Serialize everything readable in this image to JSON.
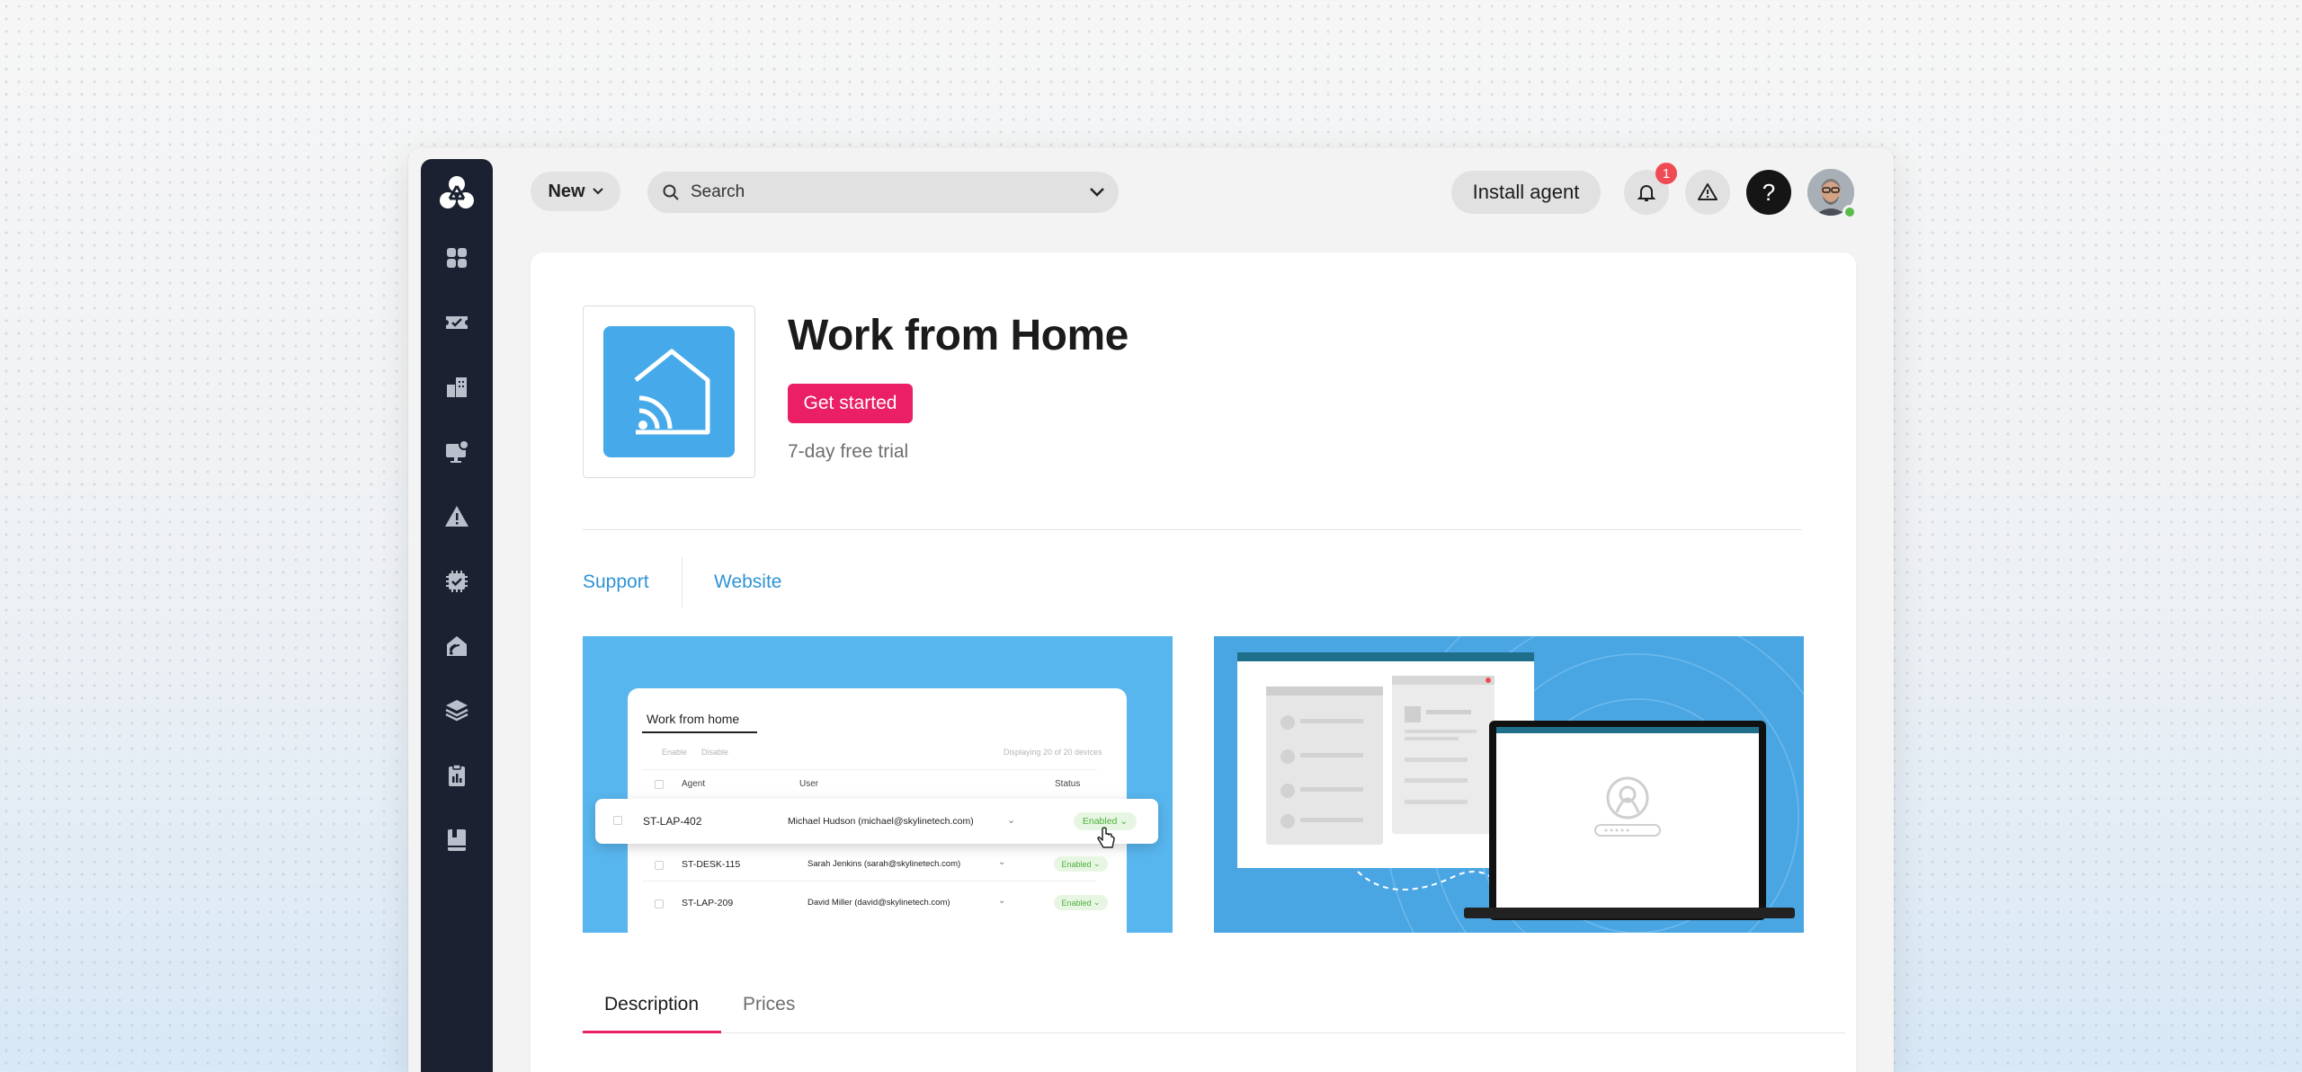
{
  "topbar": {
    "new_label": "New",
    "search_placeholder": "Search",
    "install_label": "Install agent",
    "notification_count": "1",
    "help_label": "?"
  },
  "sidebar": {
    "items": [
      {
        "icon": "dashboard-icon"
      },
      {
        "icon": "tickets-icon"
      },
      {
        "icon": "organizations-icon"
      },
      {
        "icon": "devices-icon"
      },
      {
        "icon": "alerts-icon"
      },
      {
        "icon": "patch-management-icon"
      },
      {
        "icon": "work-from-home-icon"
      },
      {
        "icon": "integrations-icon"
      },
      {
        "icon": "reports-icon"
      },
      {
        "icon": "knowledge-base-icon"
      }
    ]
  },
  "app": {
    "title": "Work from Home",
    "cta_label": "Get started",
    "trial_text": "7-day free trial",
    "icon": "home-broadcast-icon",
    "accent": "#ea1f65",
    "icon_color": "#45a9ea"
  },
  "links": {
    "support": "Support",
    "website": "Website"
  },
  "screenshot1": {
    "title": "Work from home",
    "enable": "Enable",
    "disable": "Disable",
    "displaying": "Displaying 20 of 20 devices",
    "headers": {
      "agent": "Agent",
      "user": "User",
      "status": "Status"
    },
    "rows": [
      {
        "agent": "ST-LAP-402",
        "user": "Michael Hudson (michael@skylinetech.com)",
        "status": "Enabled"
      },
      {
        "agent": "ST-DESK-115",
        "user": "Sarah Jenkins (sarah@skylinetech.com)",
        "status": "Enabled"
      },
      {
        "agent": "ST-LAP-209",
        "user": "David Miller (david@skylinetech.com)",
        "status": "Enabled"
      }
    ]
  },
  "tabs": {
    "description": "Description",
    "prices": "Prices"
  }
}
